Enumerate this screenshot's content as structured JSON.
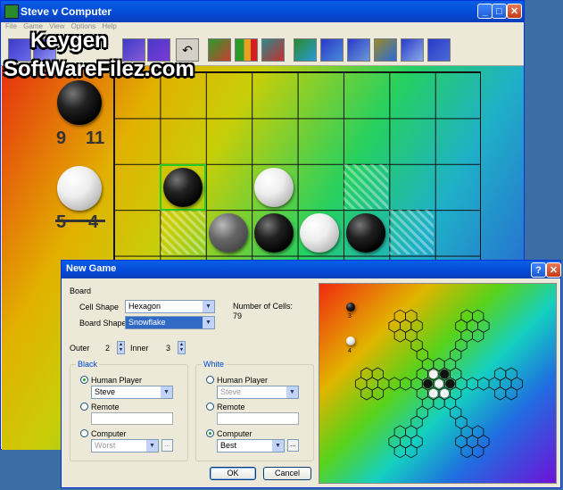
{
  "window": {
    "title": "Steve v Computer",
    "menu": [
      "File",
      "Game",
      "View",
      "Options",
      "Help"
    ]
  },
  "toolbar": {
    "icons": [
      "new-game-icon",
      "open-icon",
      "save-icon",
      "edit-icon",
      "undo-icon",
      "board-view-icon",
      "stats-icon",
      "colors-icon",
      "shape-square-icon",
      "shape-hex-icon",
      "shape-triangle-icon",
      "shape-octagon-icon",
      "shape-star-icon",
      "shape-grid-icon"
    ]
  },
  "scores": {
    "black_left": "9",
    "black_right": "11",
    "white_left": "5",
    "white_right": "4"
  },
  "watermark": {
    "line1": "Keygen",
    "line2": "SoftWareFilez.com"
  },
  "colors": {
    "xp_blue": "#0a5fe6",
    "valid_move": "#22cc22",
    "group_title": "#0046d5"
  },
  "dialog": {
    "title": "New Game",
    "board_label": "Board",
    "cell_shape_label": "Cell Shape",
    "cell_shape_value": "Hexagon",
    "board_shape_label": "Board Shape",
    "board_shape_value": "Snowflake",
    "cells_label": "Number of Cells:",
    "cells_value": "79",
    "outer_label": "Outer",
    "outer_value": "2",
    "inner_label": "Inner",
    "inner_value": "3",
    "black": {
      "title": "Black",
      "human_label": "Human Player",
      "human_value": "Steve",
      "remote_label": "Remote",
      "computer_label": "Computer",
      "computer_value": "Worst",
      "dots": "..."
    },
    "white": {
      "title": "White",
      "human_label": "Human Player",
      "human_value": "Steve",
      "remote_label": "Remote",
      "computer_label": "Computer",
      "computer_value": "Best",
      "dots": "..."
    },
    "ok": "OK",
    "cancel": "Cancel",
    "preview": {
      "black_count": "3",
      "white_count": "4"
    }
  }
}
